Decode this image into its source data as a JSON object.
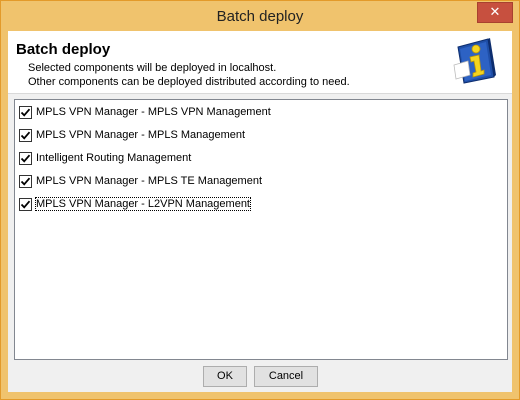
{
  "window": {
    "title": "Batch deploy",
    "close_symbol": "✕"
  },
  "header": {
    "title": "Batch deploy",
    "line1": "Selected components will be deployed in localhost.",
    "line2": "Other components can be deployed distributed according to need.",
    "icon": "info-icon"
  },
  "components": [
    {
      "label": "MPLS VPN Manager - MPLS VPN Management",
      "checked": true
    },
    {
      "label": "MPLS VPN Manager - MPLS Management",
      "checked": true
    },
    {
      "label": "Intelligent Routing Management",
      "checked": true
    },
    {
      "label": "MPLS VPN Manager - MPLS TE Management",
      "checked": true
    },
    {
      "label": "MPLS VPN Manager - L2VPN Management",
      "checked": true,
      "focused": true
    }
  ],
  "buttons": {
    "ok": "OK",
    "cancel": "Cancel"
  },
  "colors": {
    "title_bar": "#f0c36d",
    "close_button": "#c7503f",
    "info_icon_blue": "#1f4fa8",
    "info_icon_yellow": "#f5d41f"
  }
}
